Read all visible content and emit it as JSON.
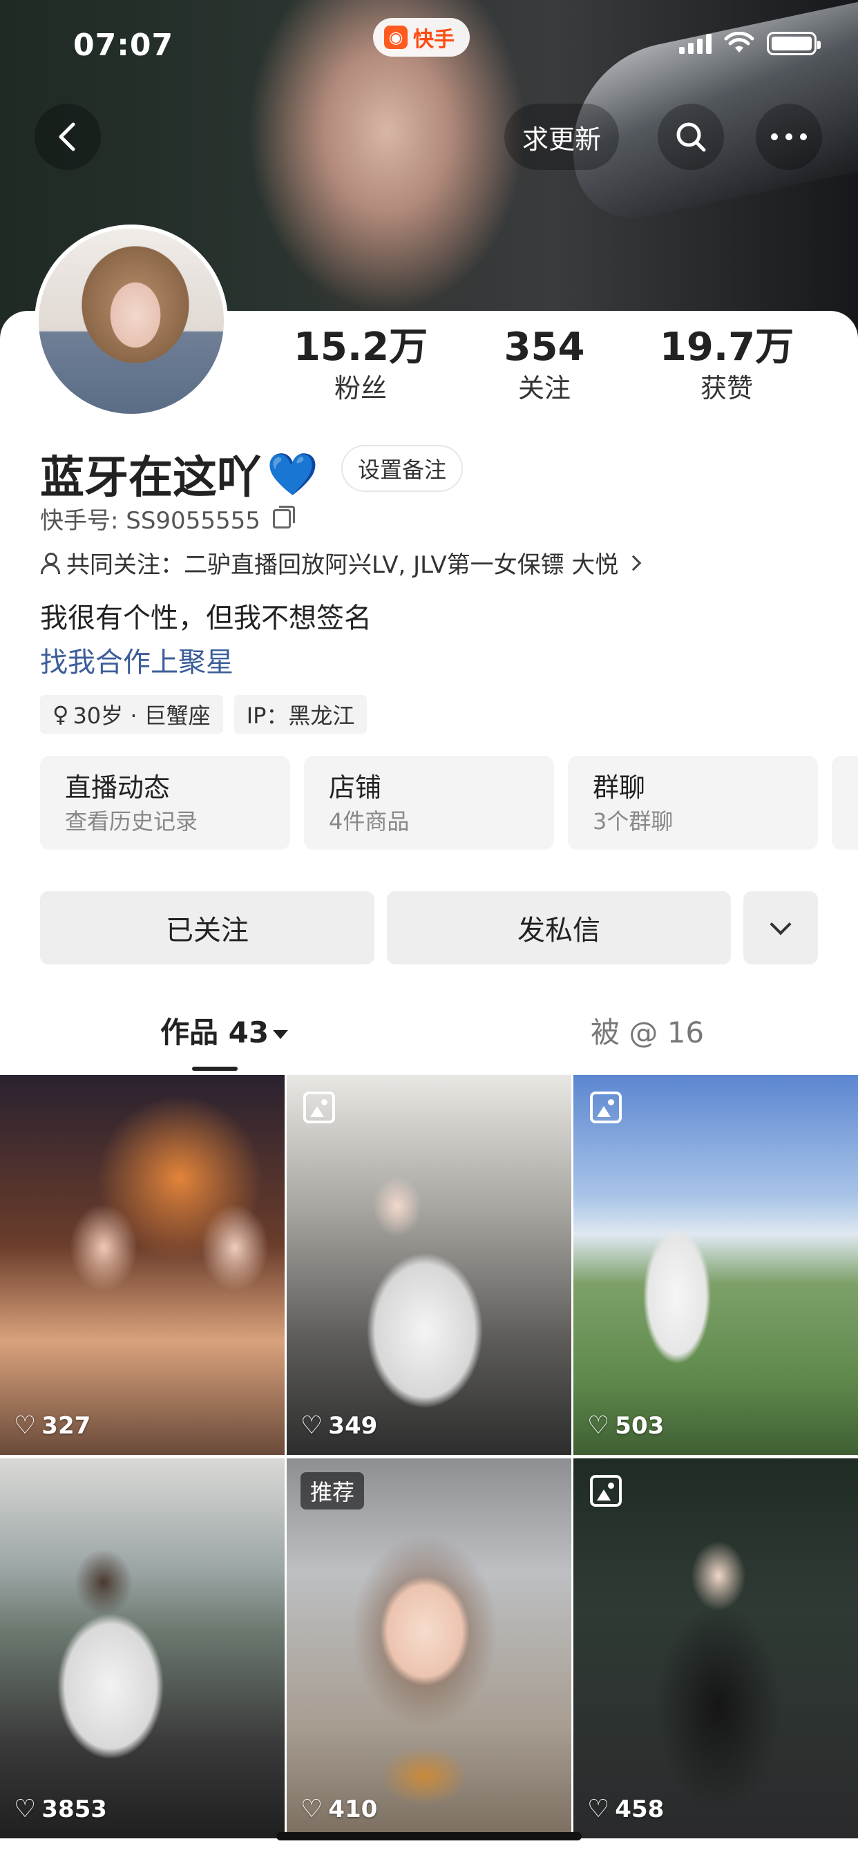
{
  "status_bar": {
    "time": "07:07"
  },
  "app_badge": {
    "label": "快手"
  },
  "header": {
    "request_update_label": "求更新"
  },
  "profile": {
    "stats": [
      {
        "value": "15.2万",
        "label": "粉丝"
      },
      {
        "value": "354",
        "label": "关注"
      },
      {
        "value": "19.7万",
        "label": "获赞"
      }
    ],
    "name": "蓝牙在这吖",
    "name_emoji": "💙",
    "remark_button": "设置备注",
    "kuaishou_id": "快手号: SS9055555",
    "mutual_follow": "共同关注：二驴直播回放阿兴LV, JLV第一女保镖 大悦",
    "bio": "我很有个性，但我不想签名",
    "link": "找我合作上聚星",
    "tags": [
      "30岁 · 巨蟹座",
      "IP：黑龙江"
    ]
  },
  "cards": [
    {
      "title": "直播动态",
      "subtitle": "查看历史记录"
    },
    {
      "title": "店铺",
      "subtitle": "4件商品"
    },
    {
      "title": "群聊",
      "subtitle": "3个群聊"
    }
  ],
  "actions": {
    "followed": "已关注",
    "message": "发私信"
  },
  "tabs": {
    "works": "作品 43",
    "mentioned": "被 @ 16"
  },
  "grid": [
    {
      "likes": "327",
      "type": "video",
      "badge": ""
    },
    {
      "likes": "349",
      "type": "gallery",
      "badge": ""
    },
    {
      "likes": "503",
      "type": "gallery",
      "badge": ""
    },
    {
      "likes": "3853",
      "type": "video",
      "badge": ""
    },
    {
      "likes": "410",
      "type": "video",
      "badge": "推荐"
    },
    {
      "likes": "458",
      "type": "gallery",
      "badge": ""
    }
  ],
  "icons": {
    "back": "chevron-left-icon",
    "search": "search-icon",
    "more": "more-icon",
    "copy": "copy-icon",
    "person": "person-icon",
    "heart": "heart-outline-icon",
    "gallery": "gallery-icon"
  },
  "colors": {
    "brand": "#ff4b12",
    "link": "#3c5e9a",
    "verified_heart": "#3a7cf5"
  }
}
